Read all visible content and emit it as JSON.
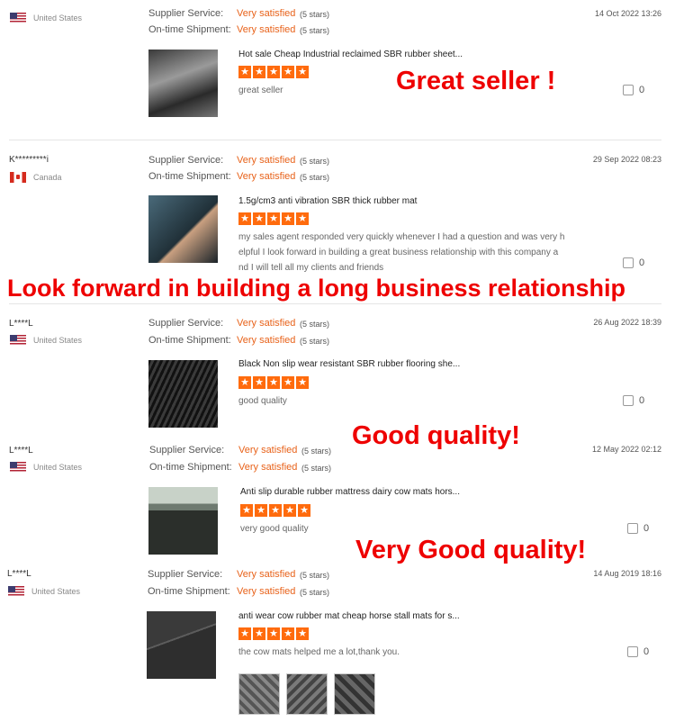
{
  "labels": {
    "supplier_service": "Supplier Service:",
    "ontime_shipment": "On-time Shipment:",
    "very_satisfied": "Very satisfied",
    "five_stars": "(5 stars)"
  },
  "reviews": [
    {
      "user": "",
      "country": "United States",
      "flag": "us",
      "date": "14 Oct 2022 13:26",
      "product": "Hot sale Cheap Industrial reclaimed SBR rubber sheet...",
      "comment": [
        "great seller"
      ],
      "likes": "0"
    },
    {
      "user": "K*********i",
      "country": "Canada",
      "flag": "ca",
      "date": "29 Sep 2022 08:23",
      "product": "1.5g/cm3 anti vibration SBR thick rubber mat",
      "comment": [
        "my sales agent responded very quickly whenever I had a question and was very h",
        "elpful I look forward in building a great business relationship with this company a",
        "nd I will tell all my clients and friends"
      ],
      "likes": "0"
    },
    {
      "user": "L****L",
      "country": "United States",
      "flag": "us",
      "date": "26 Aug 2022 18:39",
      "product": "Black Non slip wear resistant SBR rubber flooring she...",
      "comment": [
        "good quality"
      ],
      "likes": "0"
    },
    {
      "user": "L****L",
      "country": "United States",
      "flag": "us",
      "date": "12 May 2022 02:12",
      "product": "Anti slip durable rubber mattress dairy cow mats hors...",
      "comment": [
        "very good quality"
      ],
      "likes": "0"
    },
    {
      "user": "L****L",
      "country": "United States",
      "flag": "us",
      "date": "14 Aug 2019 18:16",
      "product": "anti wear cow rubber mat cheap horse stall mats for s...",
      "comment": [
        "the cow mats helped me a lot,thank you."
      ],
      "likes": "0"
    }
  ],
  "overlays": {
    "great_seller": "Great seller !",
    "long_relationship": "Look forward in building a long business relationship",
    "good_quality": "Good  quality!",
    "very_good_quality": "Very Good  quality!"
  },
  "colors": {
    "accent": "#e8621a",
    "star": "#ff6b0d",
    "overlay": "#e00000"
  },
  "icons": {
    "star": "★",
    "like": "thumbs-up-icon"
  }
}
